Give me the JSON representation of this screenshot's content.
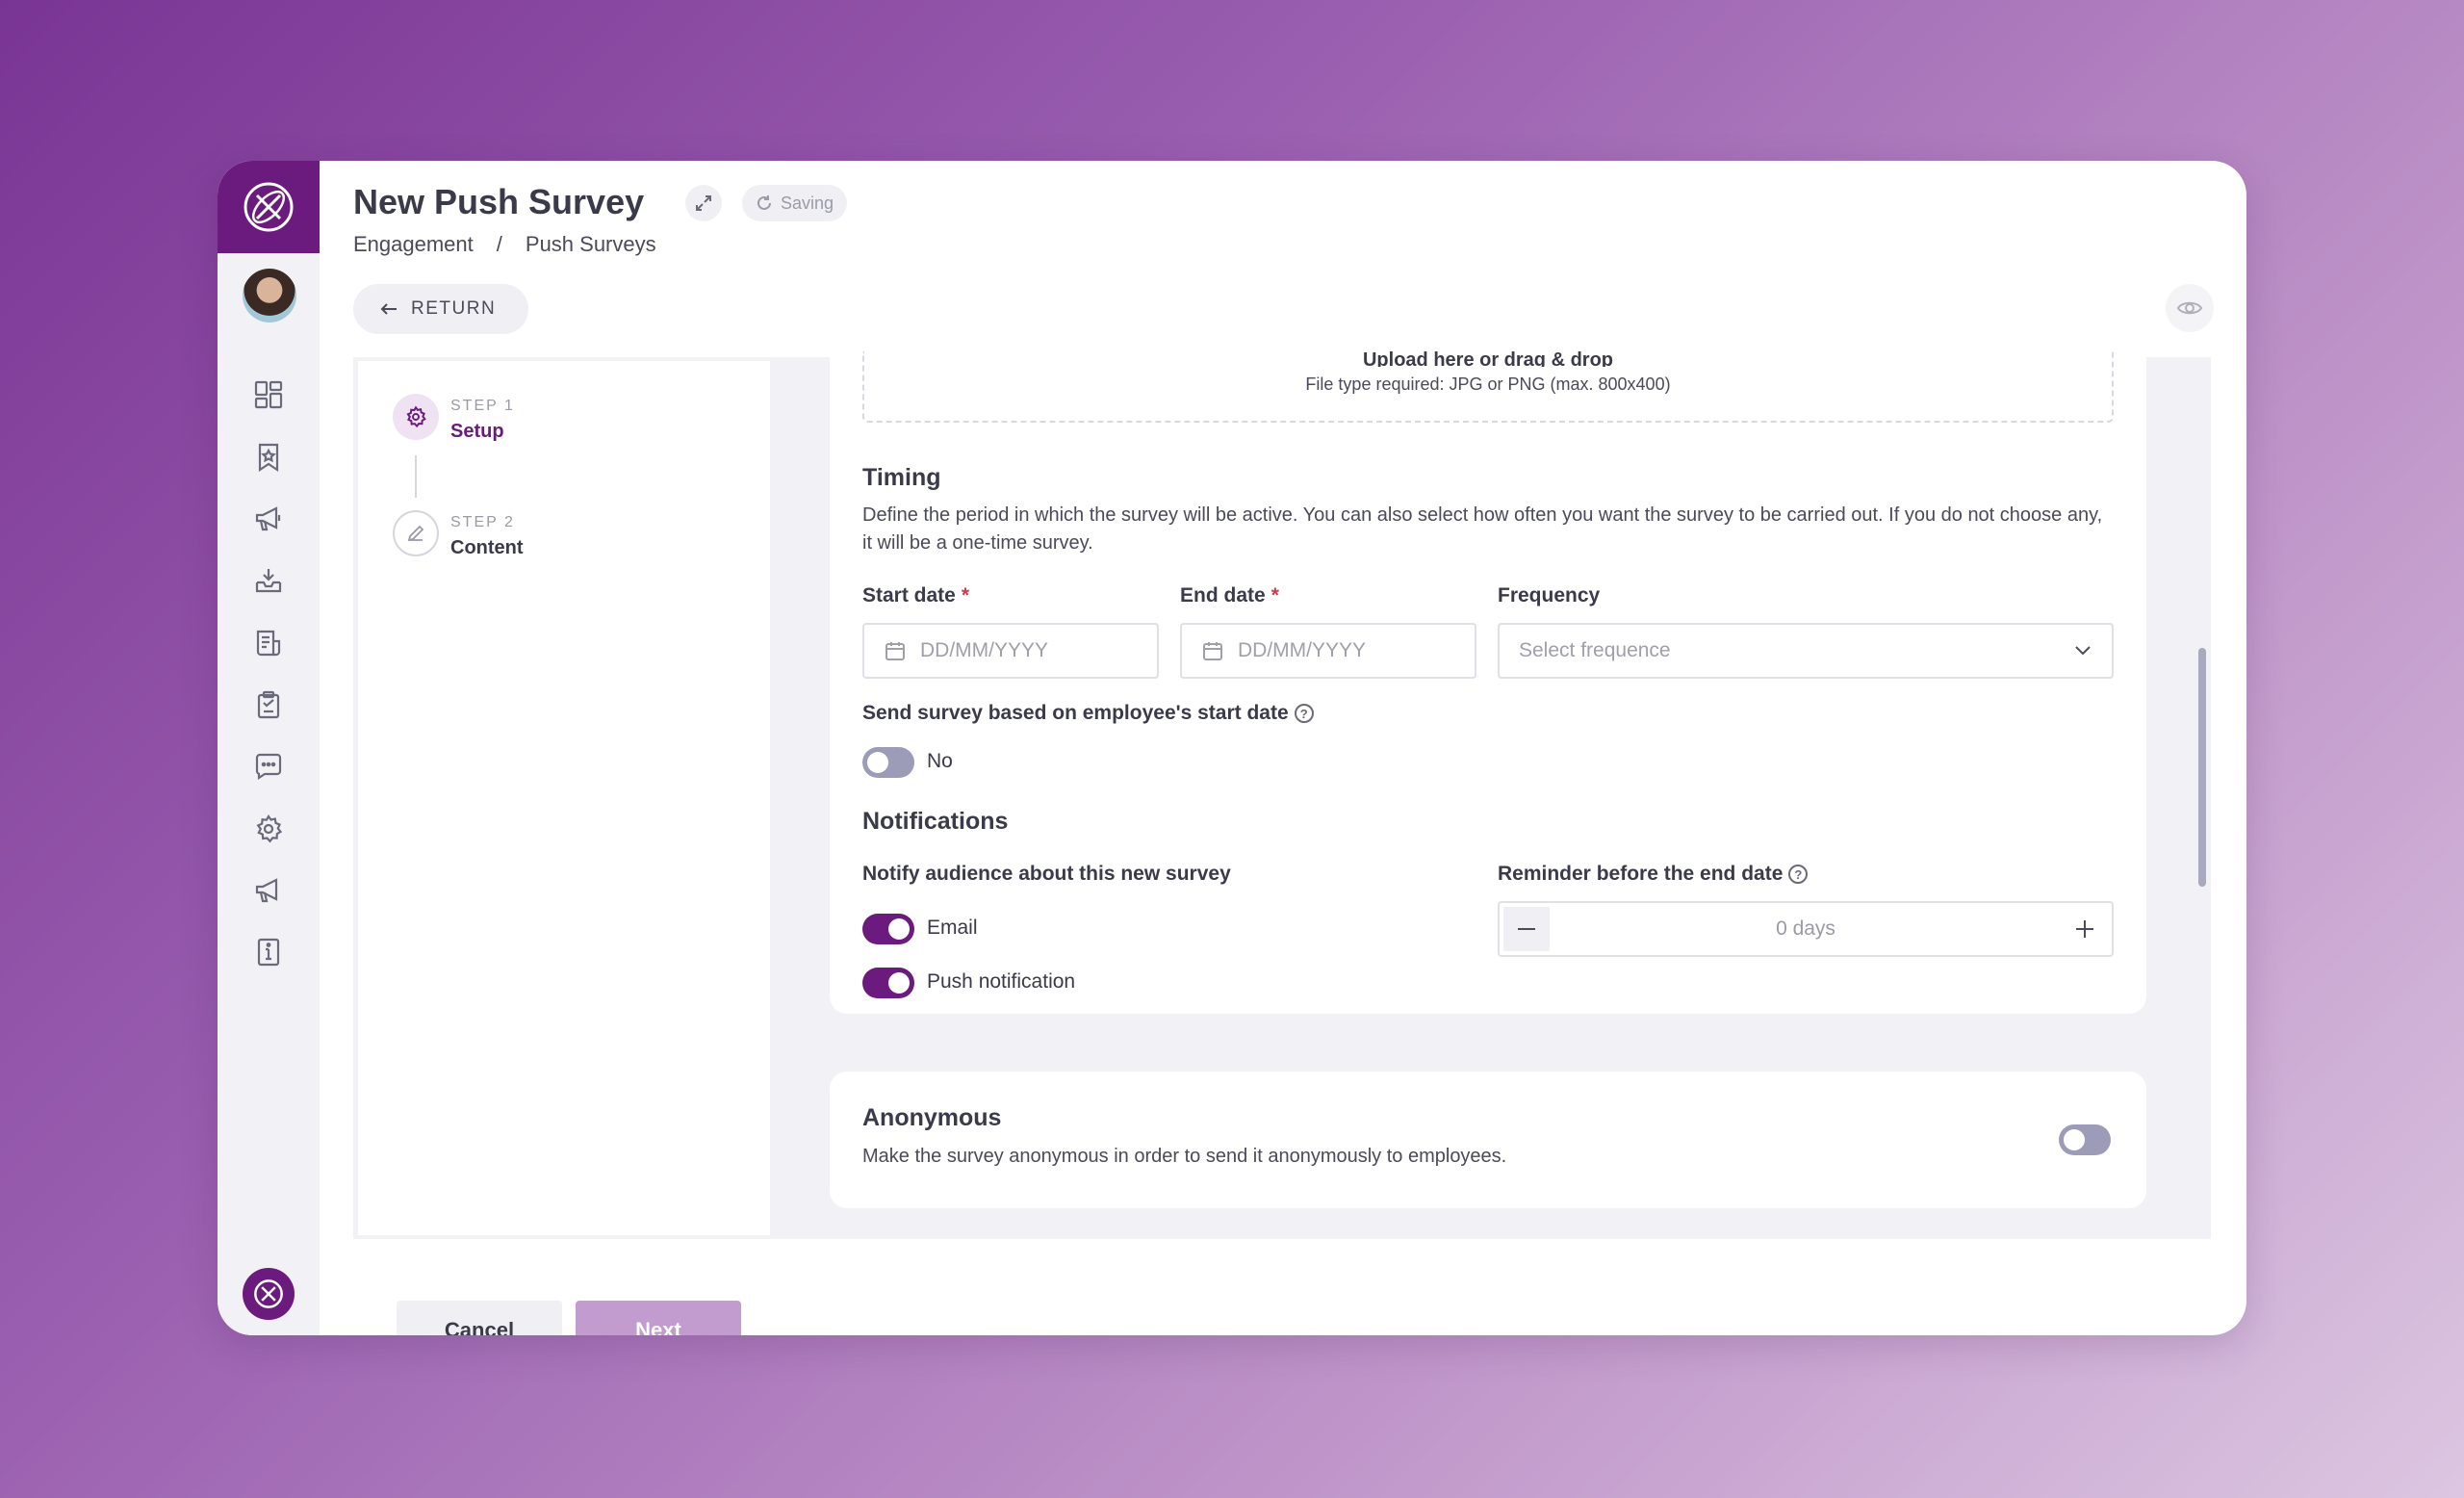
{
  "header": {
    "title": "New Push Survey",
    "saving_label": "Saving",
    "breadcrumb": [
      "Engagement",
      "/",
      "Push Surveys"
    ],
    "return_label": "RETURN"
  },
  "sidebar": {
    "items": [
      "dashboard",
      "badge",
      "announcements",
      "inbox",
      "documents",
      "surveys",
      "chat",
      "settings",
      "campaigns",
      "info"
    ]
  },
  "steps": [
    {
      "number": "STEP 1",
      "name": "Setup",
      "state": "active"
    },
    {
      "number": "STEP 2",
      "name": "Content",
      "state": "inactive"
    }
  ],
  "actions": {
    "cancel_label": "Cancel",
    "next_label": "Next"
  },
  "upload": {
    "title": "Upload here or drag & drop",
    "hint": "File type required: JPG or PNG (max. 800x400)"
  },
  "timing": {
    "heading": "Timing",
    "description": "Define the period in which the survey will be active. You can also select how often you want the survey to be carried out. If you do not choose any, it will be a one-time survey.",
    "start_label": "Start date",
    "start_placeholder": "DD/MM/YYYY",
    "end_label": "End date",
    "end_placeholder": "DD/MM/YYYY",
    "frequency_label": "Frequency",
    "frequency_placeholder": "Select frequence",
    "employee_start_label": "Send survey based on employee's start date",
    "employee_start_toggle": "No"
  },
  "notifications": {
    "heading": "Notifications",
    "notify_label": "Notify audience about this new survey",
    "email_label": "Email",
    "push_label": "Push notification",
    "reminder_label": "Reminder before the end date",
    "reminder_value": "0 days"
  },
  "anonymous": {
    "heading": "Anonymous",
    "description": "Make the survey anonymous in order to send it anonymously to employees."
  },
  "colors": {
    "brand": "#6b1a7d",
    "next_disabled": "#c29ccf",
    "toggle_off": "#9c9cb8"
  }
}
